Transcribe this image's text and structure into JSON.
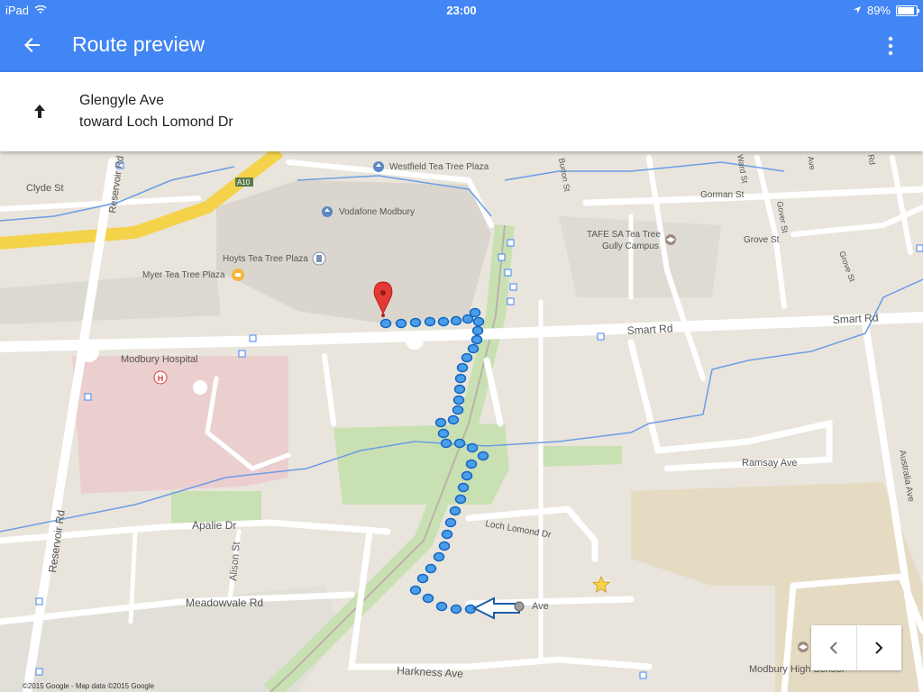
{
  "status_bar": {
    "device": "iPad",
    "time": "23:00",
    "battery": "89%",
    "battery_level": 0.89
  },
  "header": {
    "title": "Route preview",
    "back_icon": "arrow-back-icon",
    "menu_icon": "more-vert-icon"
  },
  "direction": {
    "icon": "arrow-up-icon",
    "street": "Glengyle Ave",
    "toward": "toward Loch Lomond Dr"
  },
  "map": {
    "labels": {
      "clyde": "Clyde St",
      "reservoir_n": "Reservoir Rd",
      "reservoir_s": "Reservoir Rd",
      "a10": "A10",
      "westfield": "Westfield Tea Tree Plaza",
      "vodafone": "Vodafone Modbury",
      "hoyts": "Hoyts Tea Tree Plaza",
      "myer": "Myer Tea Tree Plaza",
      "hospital": "Modbury Hospital",
      "smart_1": "Smart Rd",
      "smart_2": "Smart Rd",
      "tafe": "TAFE SA Tea Tree\nGully Campus",
      "gorman": "Gorman St",
      "grove": "Grove St",
      "gover": "Gover St",
      "grove_st2": "Grove St",
      "ward": "Ward St",
      "burton": "Burton St",
      "ave_top": "Ave",
      "rd_top": "Rd",
      "ramsay": "Ramsay Ave",
      "australia": "Australia Ave",
      "apalie": "Apalie Dr",
      "alison": "Alison St",
      "meadowvale": "Meadowvale Rd",
      "loch": "Loch Lomond Dr",
      "ave_dest": "Ave",
      "harkness": "Harkness Ave",
      "school": "Modbury High School"
    },
    "copyright": "©2015 Google - Map data ©2015 Google",
    "colors": {
      "route": "#4a9de8",
      "route_stroke": "#1565c0",
      "water": "#6b9de5",
      "park": "#c9e0b3",
      "hospital_area": "#ebcfcf",
      "highway": "#f4d24a"
    }
  },
  "nav_buttons": {
    "prev_icon": "chevron-left-icon",
    "next_icon": "chevron-right-icon"
  }
}
